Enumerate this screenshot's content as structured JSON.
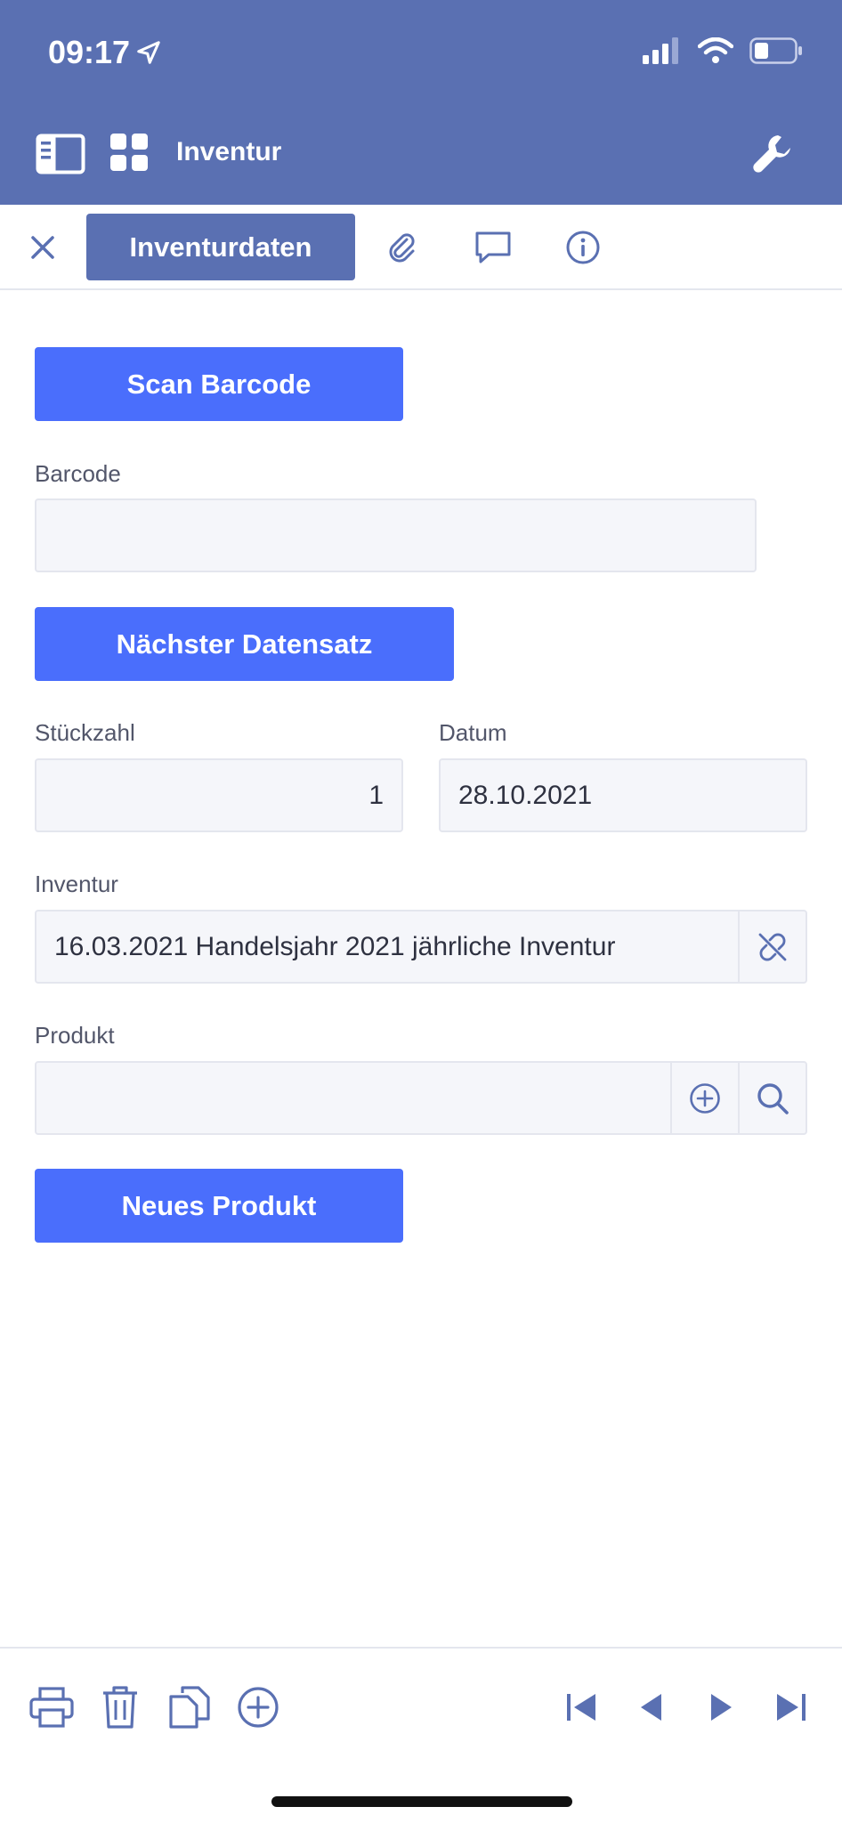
{
  "status_bar": {
    "time": "09:17"
  },
  "header": {
    "title": "Inventur"
  },
  "tabs": {
    "active_label": "Inventurdaten"
  },
  "form": {
    "scan_button": "Scan Barcode",
    "barcode": {
      "label": "Barcode",
      "value": ""
    },
    "next_button": "Nächster Datensatz",
    "quantity": {
      "label": "Stückzahl",
      "value": "1"
    },
    "date": {
      "label": "Datum",
      "value": "28.10.2021"
    },
    "inventory": {
      "label": "Inventur",
      "value": "16.03.2021 Handelsjahr 2021 jährliche Inventur"
    },
    "product": {
      "label": "Produkt",
      "value": ""
    },
    "new_product_button": "Neues Produkt"
  },
  "colors": {
    "header": "#5a70b2",
    "accent": "#4a6efc",
    "icon": "#5a70b2"
  },
  "icons": [
    "location-arrow-icon",
    "signal-icon",
    "wifi-icon",
    "battery-icon",
    "sidebar-icon",
    "grid-icon",
    "wrench-icon",
    "close-icon",
    "paperclip-icon",
    "comment-icon",
    "info-icon",
    "unlink-icon",
    "plus-circle-icon",
    "search-icon",
    "print-icon",
    "trash-icon",
    "copy-icon",
    "add-icon",
    "first-icon",
    "prev-icon",
    "next-icon",
    "last-icon"
  ]
}
